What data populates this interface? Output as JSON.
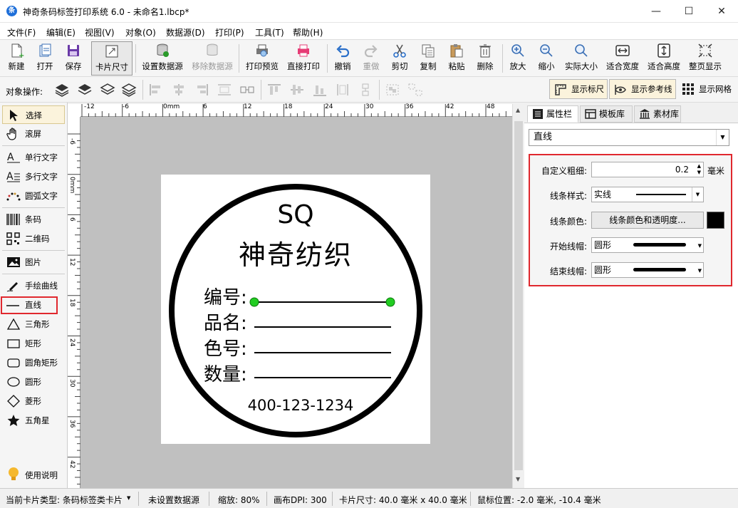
{
  "window": {
    "app_icon": "app-logo-icon",
    "app_icon_letter": "条",
    "title": "神奇条码标签打印系统 6.0 - 未命名1.lbcp*"
  },
  "menu": [
    "文件(F)",
    "编辑(E)",
    "视图(V)",
    "对象(O)",
    "数据源(D)",
    "打印(P)",
    "工具(T)",
    "帮助(H)"
  ],
  "toolbar": {
    "new": "新建",
    "open": "打开",
    "save": "保存",
    "card_size": "卡片尺寸",
    "set_datasource": "设置数据源",
    "remove_datasource": "移除数据源",
    "print_preview": "打印预览",
    "direct_print": "直接打印",
    "undo": "撤销",
    "redo": "重做",
    "cut": "剪切",
    "copy": "复制",
    "paste": "粘贴",
    "delete": "删除",
    "zoom_in": "放大",
    "zoom_out": "缩小",
    "actual_size": "实际大小",
    "fit_width": "适合宽度",
    "fit_height": "适合高度",
    "fit_page": "整页显示"
  },
  "toolbar2": {
    "object_ops": "对象操作:",
    "show_ruler": "显示标尺",
    "show_guides": "显示参考线",
    "show_grid": "显示网格"
  },
  "tools": {
    "select": "选择",
    "scroll": "滚屏",
    "single_text": "单行文字",
    "multi_text": "多行文字",
    "arc_text": "圆弧文字",
    "barcode": "条码",
    "qrcode": "二维码",
    "image": "图片",
    "freehand": "手绘曲线",
    "line": "直线",
    "triangle": "三角形",
    "rect": "矩形",
    "round_rect": "圆角矩形",
    "ellipse": "圆形",
    "diamond": "菱形",
    "star": "五角星",
    "help": "使用说明"
  },
  "ruler": {
    "h_ticks": [
      "-12",
      "-6",
      "0mm",
      "6",
      "12",
      "18",
      "24",
      "30",
      "36",
      "42",
      "48"
    ],
    "v_ticks": [
      "-6",
      "0mm",
      "6",
      "12",
      "18",
      "24",
      "30",
      "36",
      "42"
    ]
  },
  "label": {
    "title_line1": "SQ",
    "title_line2": "神奇纺织",
    "field1": "编号:",
    "field2": "品名:",
    "field3": "色号:",
    "field4": "数量:",
    "phone": "400-123-1234"
  },
  "right_panel": {
    "tab_props": "属性栏",
    "tab_templates": "模板库",
    "tab_assets": "素材库",
    "object_type": "直线",
    "width_label": "自定义粗细:",
    "width_value": "0.2",
    "width_unit": "毫米",
    "style_label": "线条样式:",
    "style_value": "实线",
    "color_label": "线条颜色:",
    "color_button": "线条颜色和透明度...",
    "line_color": "#000000",
    "start_cap_label": "开始线帽:",
    "start_cap_value": "圆形",
    "end_cap_label": "结束线帽:",
    "end_cap_value": "圆形"
  },
  "status": {
    "card_type": "当前卡片类型: 条码标签类卡片",
    "datasource": "未设置数据源",
    "zoom": "缩放: 80%",
    "dpi": "画布DPI: 300",
    "card_size": "卡片尺寸: 40.0 毫米 x 40.0 毫米",
    "mouse_pos": "鼠标位置: -2.0 毫米, -10.4 毫米"
  },
  "colors": {
    "highlight": "#e0282e",
    "handle": "#22cc22",
    "accent": "#1e6fd9"
  }
}
